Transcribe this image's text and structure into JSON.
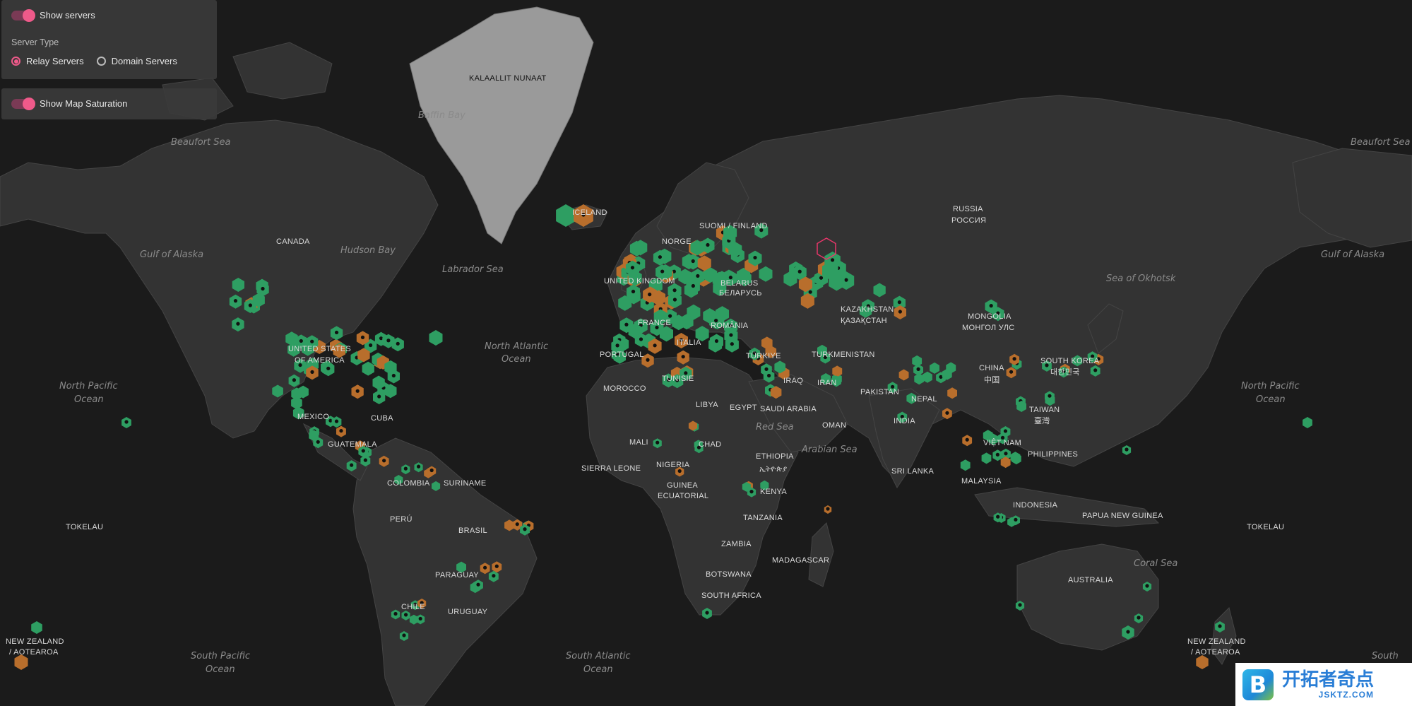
{
  "controls": {
    "show_servers_label": "Show servers",
    "show_servers_on": true,
    "server_type_label": "Server Type",
    "server_types": [
      {
        "label": "Relay Servers",
        "selected": true
      },
      {
        "label": "Domain Servers",
        "selected": false
      }
    ],
    "show_saturation_label": "Show Map Saturation",
    "show_saturation_on": true
  },
  "colors": {
    "background": "#1b1b1b",
    "land": "#333333",
    "greenland": "#9a9a9a",
    "relay_green": "#2e9e62",
    "relay_orange": "#b86e2c",
    "highlight": "#e8366a",
    "toggle_accent": "#ef5a8a"
  },
  "ocean_labels": {
    "beaufort_w": "Beaufort Sea",
    "beaufort_e": "Beaufort Sea",
    "baffin": "Baffin Bay",
    "hudson": "Hudson Bay",
    "labrador": "Labrador Sea",
    "alaska_w": "Gulf of Alaska",
    "alaska_e": "Gulf of Alaska",
    "okhotsk": "Sea of Okhotsk",
    "npac_w_1": "North Pacific",
    "npac_w_2": "Ocean",
    "npac_e_1": "North Pacific",
    "npac_e_2": "Ocean",
    "natl_1": "North Atlantic",
    "natl_2": "Ocean",
    "red_sea": "Red Sea",
    "arabian": "Arabian Sea",
    "coral": "Coral Sea",
    "spac_w_1": "South Pacific",
    "spac_w_2": "Ocean",
    "spac_e": "South",
    "satl_1": "South Atlantic",
    "satl_2": "Ocean"
  },
  "country_labels": {
    "greenland": "KALAALLIT NUNAAT",
    "iceland": "ICELAND",
    "canada": "CANADA",
    "usa_1": "UNITED STATES",
    "usa_2": "OF AMERICA",
    "mexico": "MEXICO",
    "cuba": "CUBA",
    "guatemala": "GUATEMALA",
    "colombia": "COLOMBIA",
    "suriname": "SURINAME",
    "peru": "PERÚ",
    "brasil": "BRASIL",
    "paraguay": "PARAGUAY",
    "chile": "CHILE",
    "uruguay": "URUGUAY",
    "tokelau_w": "TOKELAU",
    "tokelau_e": "TOKELAU",
    "nz_w_1": "NEW ZEALAND",
    "nz_w_2": "/ AOTEAROA",
    "nz_e_1": "NEW ZEALAND",
    "nz_e_2": "/ AOTEAROA",
    "norge": "NORGE",
    "suomi": "SUOMI / FINLAND",
    "uk": "UNITED KINGDOM",
    "belarus_1": "BELARUS",
    "belarus_2": "БЕЛАРУСЬ",
    "france": "FRANCE",
    "romania": "ROMÂNIA",
    "italia": "ITALIA",
    "portugal": "PORTUGAL",
    "turkiye": "TÜRKIYE",
    "tunisie": "TUNISIE",
    "morocco": "MOROCCO",
    "libya": "LIBYA",
    "egypt": "EGYPT",
    "mali": "MALI",
    "chad": "CHAD",
    "nigeria": "NIGERIA",
    "sierra_leone": "SIERRA LEONE",
    "ethiopia_1": "ETHIOPIA",
    "ethiopia_2": "ኢትዮጵያ",
    "guinea": "GUINEA",
    "ecuatorial": "ECUATORIAL",
    "kenya": "KENYA",
    "tanzania": "TANZANIA",
    "zambia": "ZAMBIA",
    "botswana": "BOTSWANA",
    "madagascar": "MADAGASCAR",
    "south_africa": "SOUTH AFRICA",
    "russia_1": "RUSSIA",
    "russia_2": "РОССИЯ",
    "kazakhstan_1": "KAZAKHSTAN",
    "kazakhstan_2": "ҚАЗАҚСТАН",
    "turkmenistan": "TURKMENISTAN",
    "iraq": "IRAQ",
    "iran": "IRAN",
    "saudi": "SAUDI ARABIA",
    "oman": "OMAN",
    "pakistan": "PAKISTAN",
    "nepal": "NEPAL",
    "india": "INDIA",
    "sri_lanka": "SRI LANKA",
    "mongolia_1": "MONGOLIA",
    "mongolia_2": "МОНГОЛ УЛС",
    "china_1": "CHINA",
    "china_2": "中国",
    "south_korea_1": "SOUTH KOREA",
    "south_korea_2": "대한민국",
    "taiwan_1": "TAIWAN",
    "taiwan_2": "臺灣",
    "vietnam": "VIỆT NAM",
    "philippines": "PHILIPPINES",
    "malaysia": "MALAYSIA",
    "indonesia": "INDONESIA",
    "png": "PAPUA NEW GUINEA",
    "australia": "AUSTRALIA"
  },
  "brand": {
    "logo_letter": "B",
    "name_cn": "开拓者奇点",
    "name_en": "JSKTZ.COM"
  }
}
